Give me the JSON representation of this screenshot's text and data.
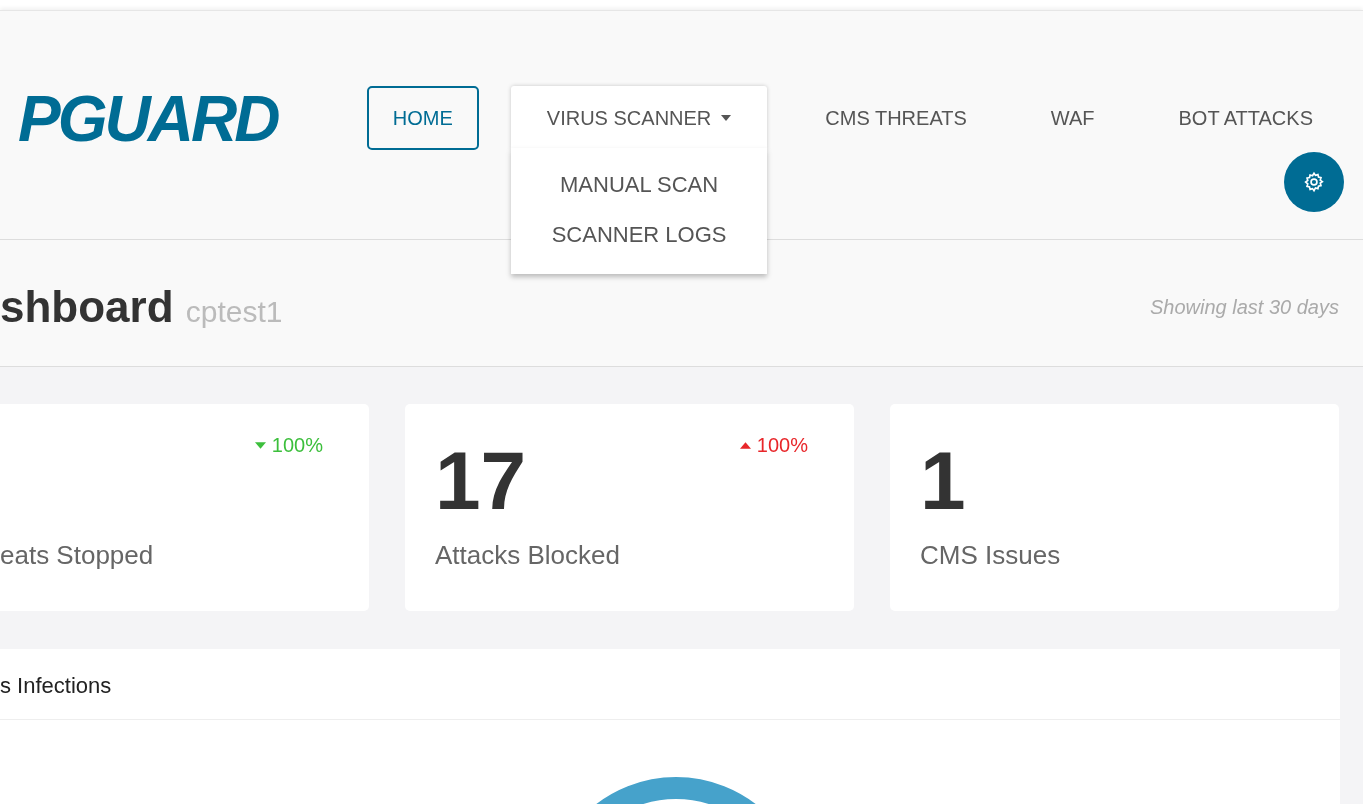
{
  "logo": {
    "text": "PGUARD"
  },
  "nav": [
    {
      "label": "HOME",
      "selected": true
    },
    {
      "label": "VIRUS SCANNER",
      "selected": false,
      "expanded": true,
      "menu": [
        "MANUAL SCAN",
        "SCANNER LOGS"
      ]
    },
    {
      "label": "CMS THREATS",
      "selected": false
    },
    {
      "label": "WAF",
      "selected": false
    },
    {
      "label": "BOT ATTACKS",
      "selected": false
    }
  ],
  "page": {
    "title": "shboard",
    "user": "cptest1",
    "range": "Showing last 30 days"
  },
  "stats": [
    {
      "label": "eats Stopped",
      "change": "100%",
      "trend_up": false
    },
    {
      "value": "17",
      "label": "Attacks Blocked",
      "change": "100%",
      "trend_up": true
    },
    {
      "value": "1",
      "label": "CMS Issues"
    }
  ],
  "panel": {
    "title": "s Infections"
  }
}
